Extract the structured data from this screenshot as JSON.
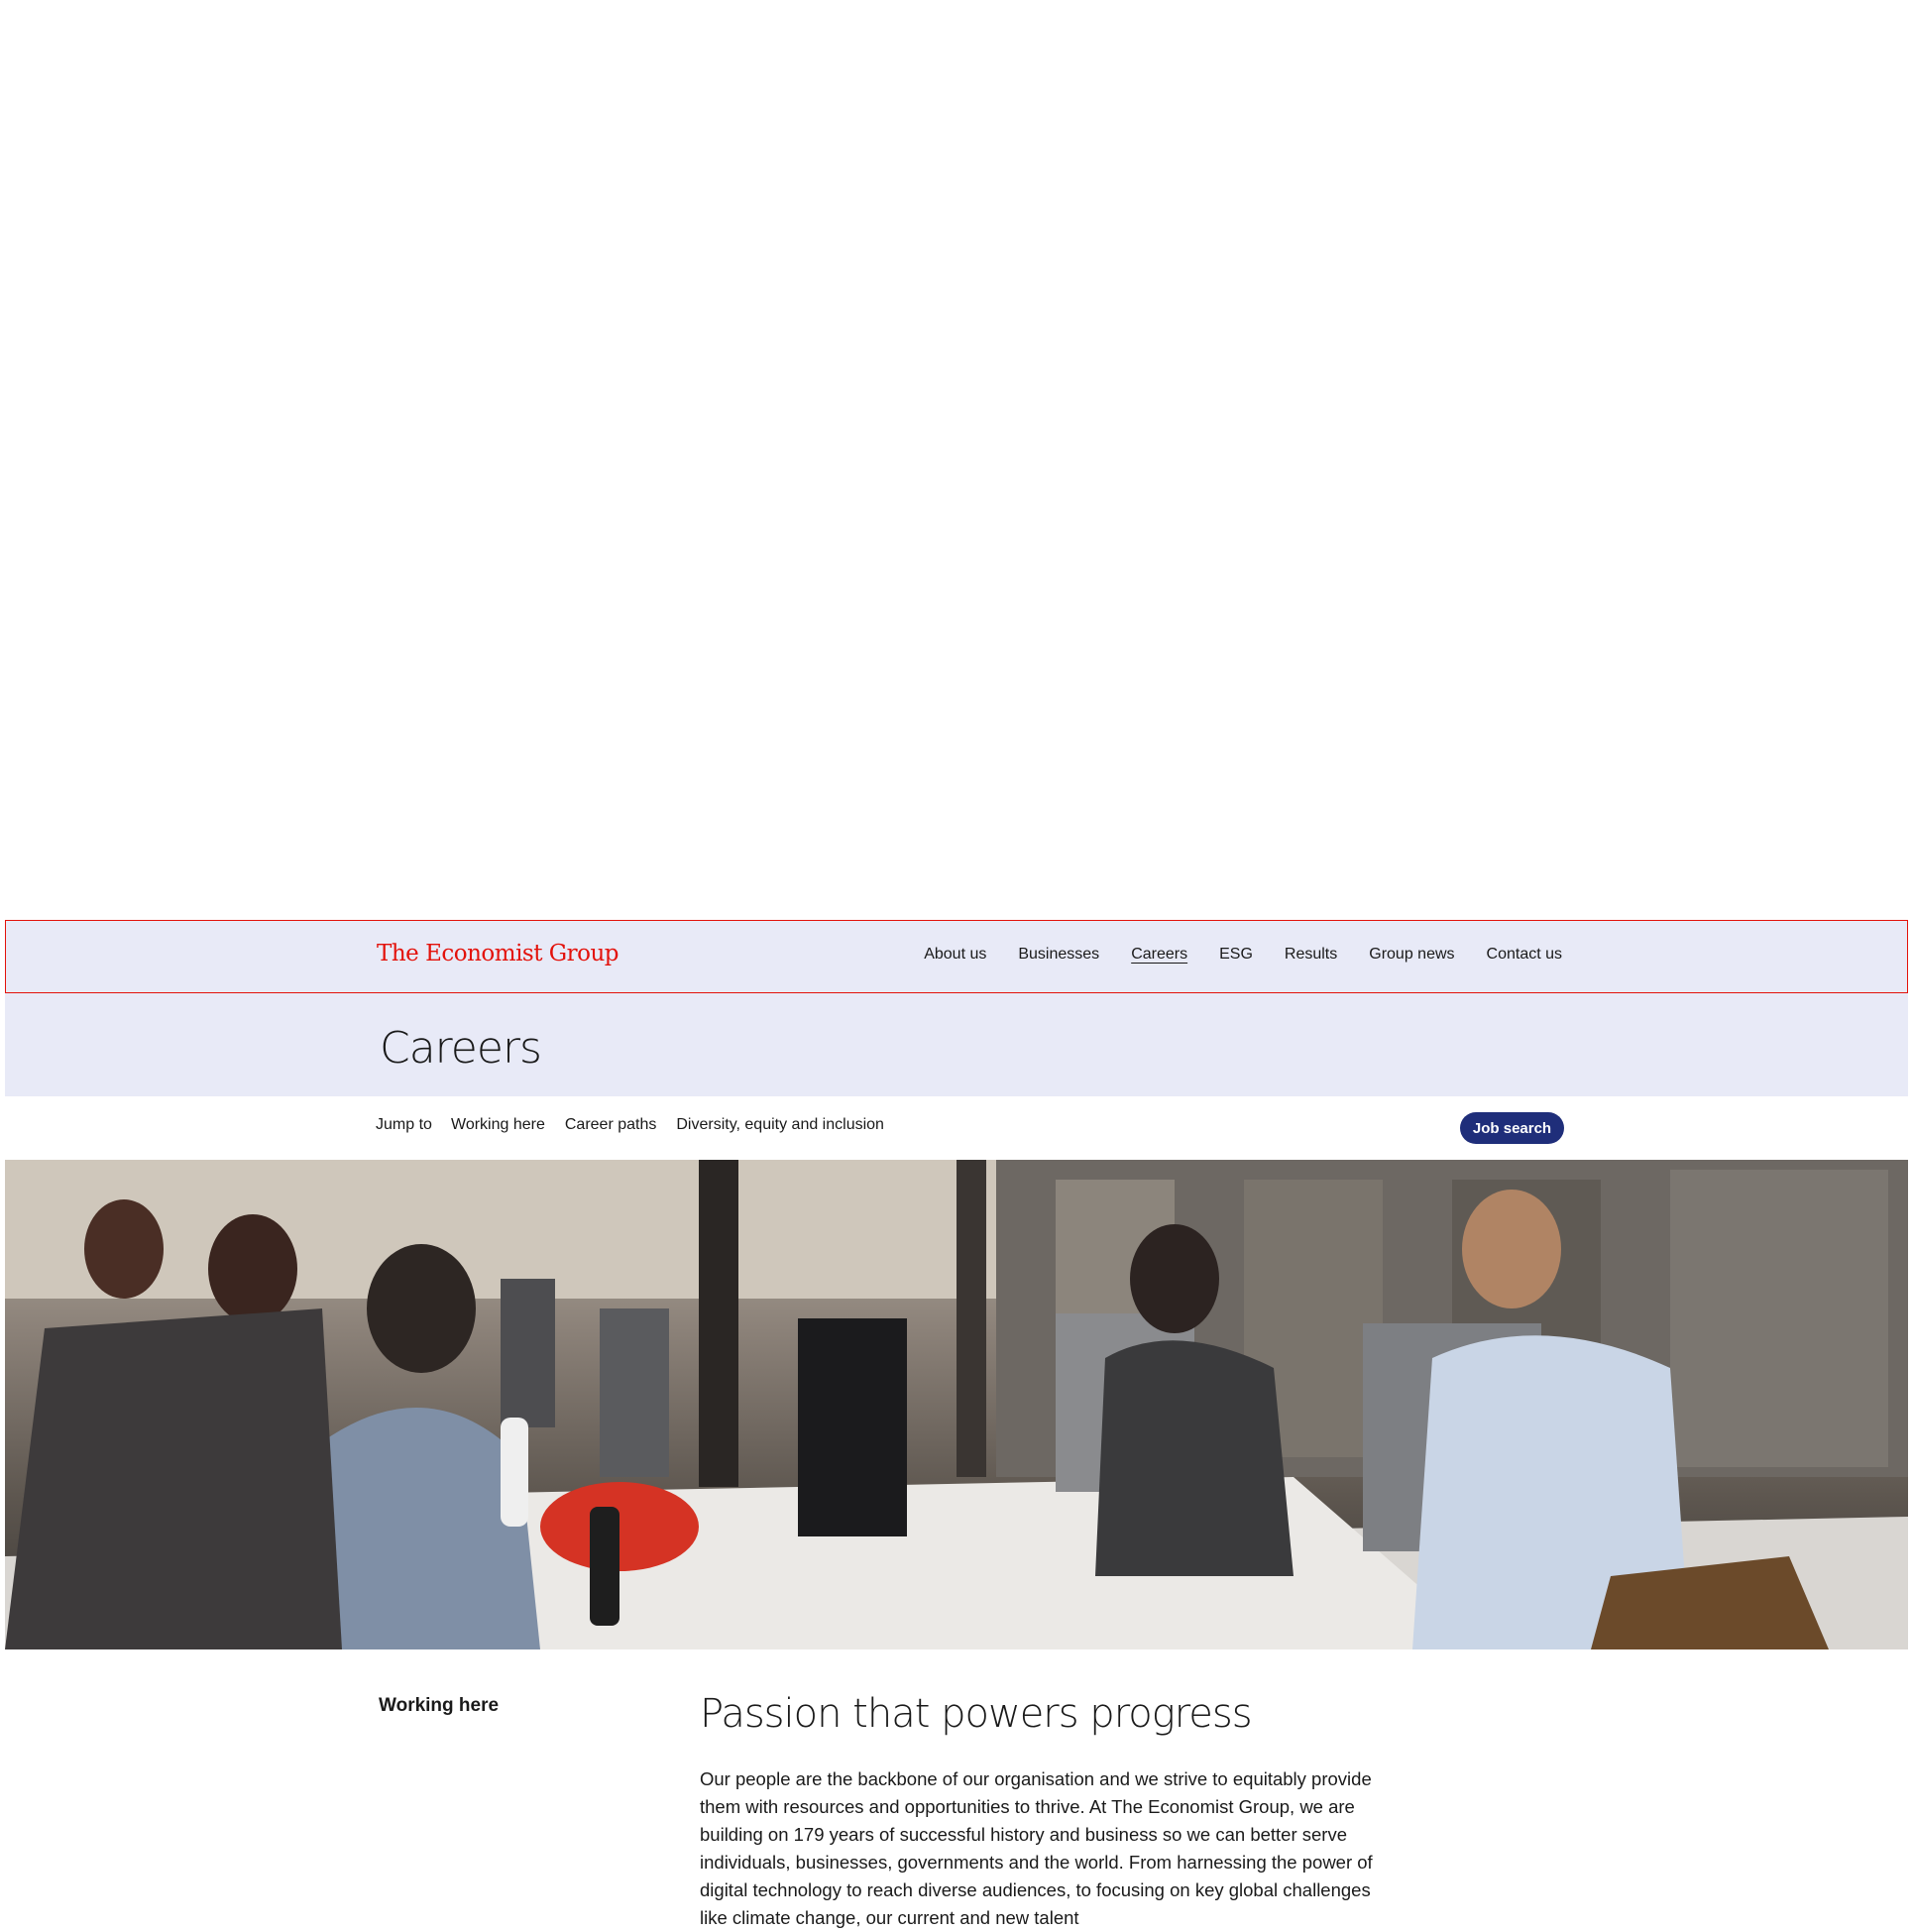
{
  "header": {
    "logo_text": "The Economist Group",
    "nav": [
      {
        "label": "About us"
      },
      {
        "label": "Businesses"
      },
      {
        "label": "Careers",
        "active": true
      },
      {
        "label": "ESG"
      },
      {
        "label": "Results"
      },
      {
        "label": "Group news"
      },
      {
        "label": "Contact us"
      }
    ]
  },
  "page": {
    "title": "Careers"
  },
  "jump": {
    "label": "Jump to",
    "links": [
      {
        "label": "Working here"
      },
      {
        "label": "Career paths"
      },
      {
        "label": "Diversity, equity and inclusion"
      }
    ],
    "cta_label": "Job search"
  },
  "section": {
    "side_label": "Working here",
    "heading": "Passion that powers progress",
    "body": "Our people are the backbone of our organisation and we strive to equitably provide them with resources and opportunities to thrive. At The Economist Group, we are building on 179 years of successful history and business so we can better serve individuals, businesses, governments and the world. From harnessing the power of digital technology to reach diverse audiences, to focusing on key global challenges like climate change, our current and new talent"
  },
  "colors": {
    "brand_red": "#e3120b",
    "header_bg": "#e8eaf7",
    "cta_bg": "#1f2e7a"
  }
}
